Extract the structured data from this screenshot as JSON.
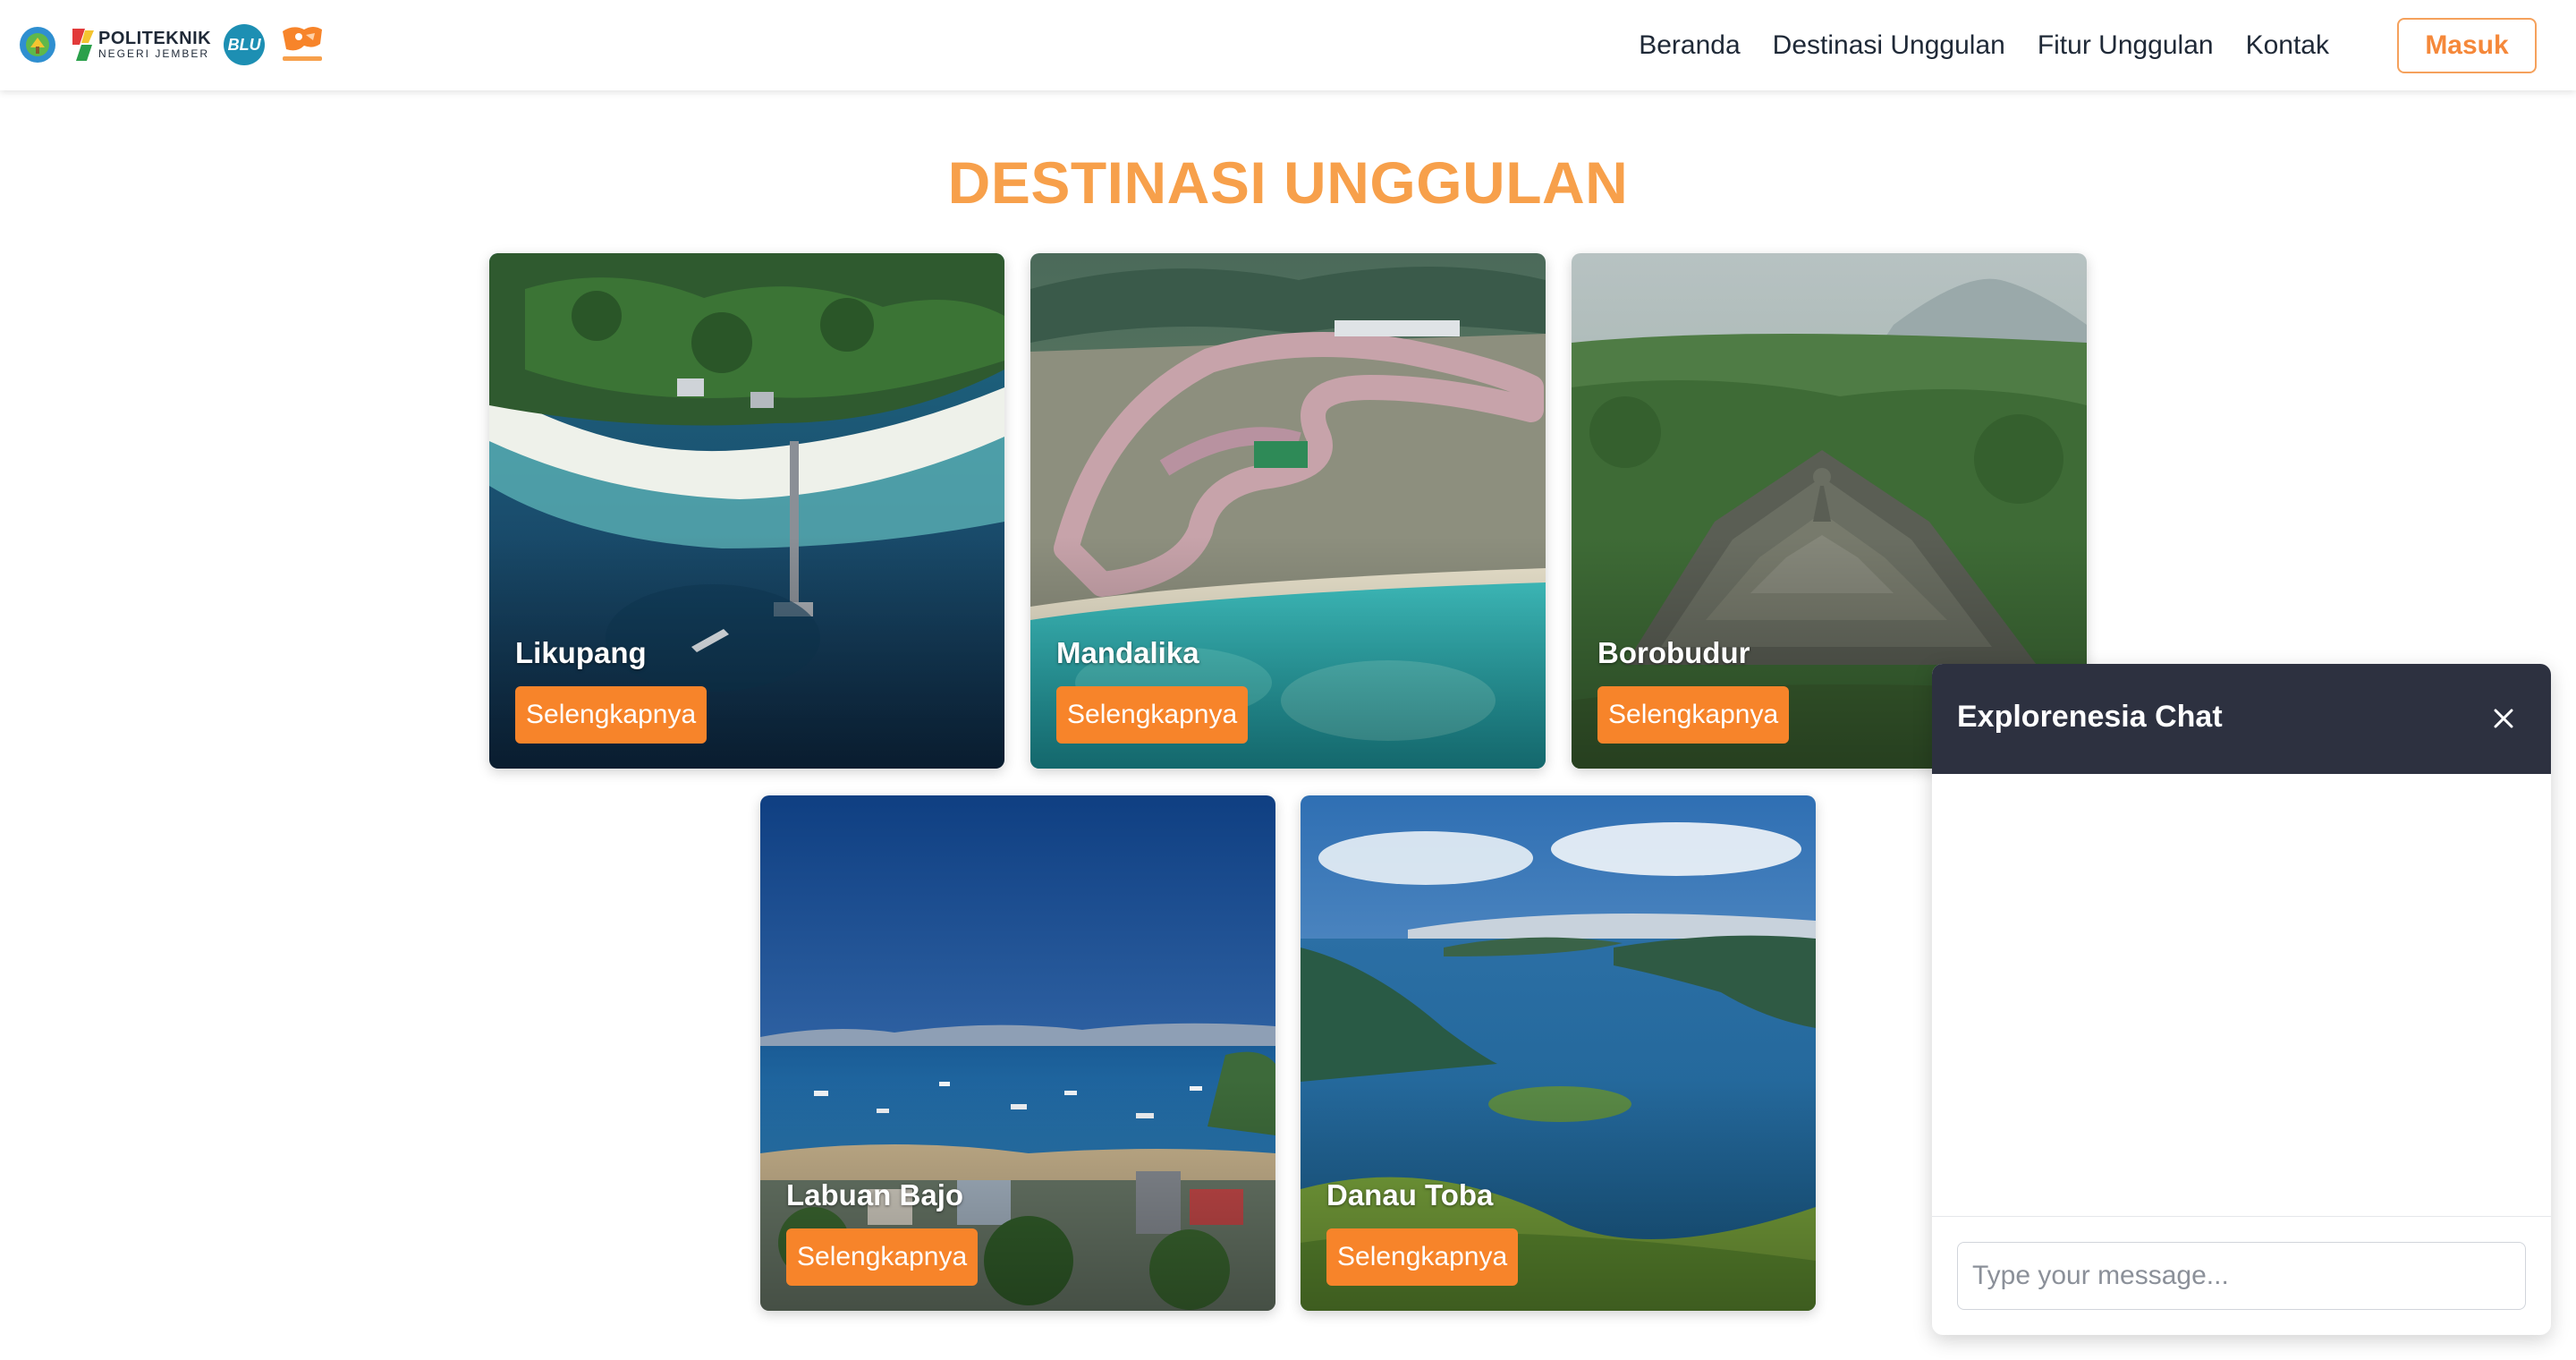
{
  "navbar": {
    "logos": {
      "poltek_line1": "POLITEKNIK",
      "poltek_line2": "NEGERI JEMBER",
      "blu_text": "BLU"
    },
    "links": [
      {
        "label": "Beranda"
      },
      {
        "label": "Destinasi Unggulan"
      },
      {
        "label": "Fitur Unggulan"
      },
      {
        "label": "Kontak"
      }
    ],
    "login_label": "Masuk"
  },
  "section": {
    "title": "DESTINASI UNGGULAN"
  },
  "cards": [
    {
      "title": "Likupang",
      "button": "Selengkapnya",
      "scene": "island-pier"
    },
    {
      "title": "Mandalika",
      "button": "Selengkapnya",
      "scene": "race-circuit"
    },
    {
      "title": "Borobudur",
      "button": "Selengkapnya",
      "scene": "temple"
    },
    {
      "title": "Labuan Bajo",
      "button": "Selengkapnya",
      "scene": "harbor"
    },
    {
      "title": "Danau Toba",
      "button": "Selengkapnya",
      "scene": "lake"
    }
  ],
  "chat": {
    "title": "Explorenesia Chat",
    "input_placeholder": "Type your message...",
    "close_icon": "close-icon"
  },
  "colors": {
    "accent_orange": "#f7842a",
    "title_orange": "#f7a04b",
    "chat_header": "#2d3140"
  }
}
